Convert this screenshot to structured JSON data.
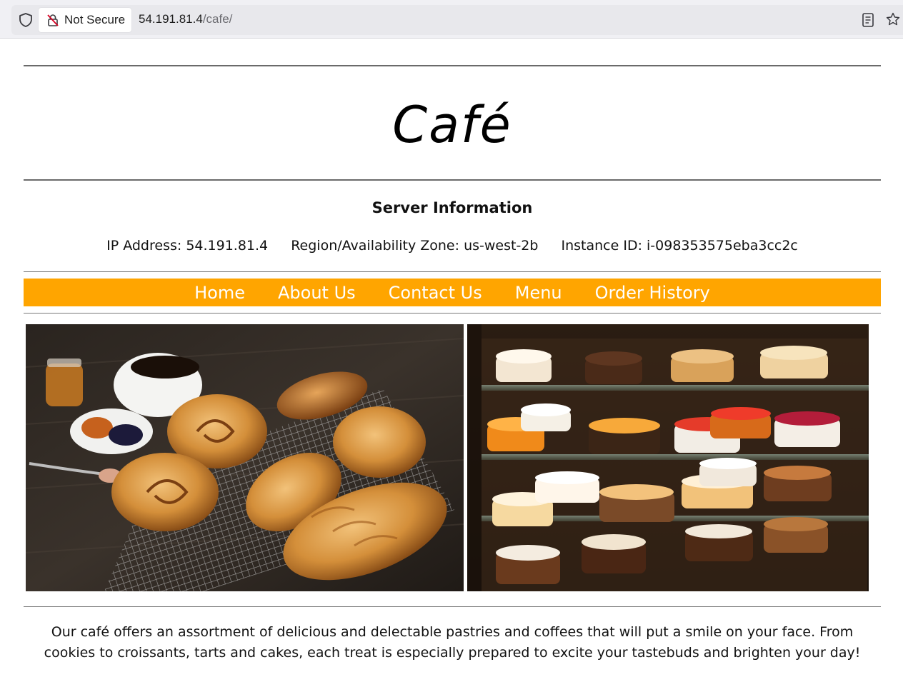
{
  "browser": {
    "security_label": "Not Secure",
    "url_host": "54.191.81.4",
    "url_path": "/cafe/"
  },
  "site": {
    "title": "Café"
  },
  "server": {
    "heading": "Server Information",
    "ip_address": "IP Address: 54.191.81.4",
    "region": "Region/Availability Zone: us-west-2b",
    "instance_id": "Instance ID: i-098353575eba3cc2c"
  },
  "nav": {
    "items": [
      {
        "label": "Home"
      },
      {
        "label": "About Us"
      },
      {
        "label": "Contact Us"
      },
      {
        "label": "Menu"
      },
      {
        "label": "Order History"
      }
    ],
    "background_color": "#ffa500"
  },
  "description": "Our café offers an assortment of delicious and delectable pastries and coffees that will put a smile on your face. From cookies to croissants, tarts and cakes, each treat is especially prepared to excite your tastebuds and brighten your day!"
}
